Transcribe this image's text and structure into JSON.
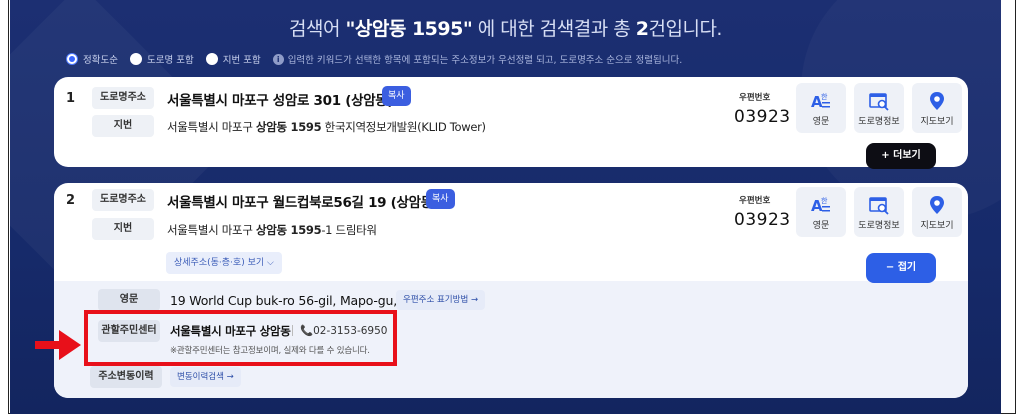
{
  "headline": {
    "prefix": "검색어 ",
    "keyword": "\"상암동 1595\"",
    "middle": " 에 대한 검색결과 총 ",
    "count": "2",
    "suffix": "건입니다."
  },
  "options": {
    "exact": "정확도순",
    "road": "도로명 포함",
    "jibun": "지번 포함",
    "info": "입력한 키워드가 선택한 항목에 포함되는 주소정보가 우선정렬 되고, 도로명주소 순으로 정렬됩니다."
  },
  "results": [
    {
      "num": "1",
      "road_tag": "도로명주소",
      "road_addr": "서울특별시 마포구 성암로 301 (상암동)",
      "copy": "복사",
      "jibun_tag": "지번",
      "jibun_pre": "서울특별시 마포구 ",
      "jibun_bold": "상암동 1595",
      "jibun_post": " 한국지역정보개발원(KLID Tower)",
      "zip_label": "우편번호",
      "zip": "03923",
      "btn_en": "영문",
      "btn_info": "도로명정보",
      "btn_map": "지도보기",
      "more": "+ 더보기"
    },
    {
      "num": "2",
      "road_tag": "도로명주소",
      "road_addr": "서울특별시 마포구 월드컵북로56길 19 (상암동)",
      "copy": "복사",
      "jibun_tag": "지번",
      "jibun_pre": "서울특별시 마포구 ",
      "jibun_bold": "상암동 1595",
      "jibun_post": "-1 드림타워",
      "zip_label": "우편번호",
      "zip": "03923",
      "btn_en": "영문",
      "btn_info": "도로명정보",
      "btn_map": "지도보기",
      "detail": "상세주소(동·층·호) 보기",
      "fold": "− 접기",
      "en_tag": "영문",
      "en_addr": "19 World Cup buk-ro 56-gil, Mapo-gu, Seoul",
      "en_btn": "우편주소 표기방법 →",
      "center_tag": "관할주민센터",
      "center_name": "서울특별시 마포구 상암동",
      "center_phone": "02-3153-6950",
      "center_note": "※관할주민센터는 참고정보이며, 실제와 다를 수 있습니다.",
      "history_tag": "주소변동이력",
      "history_btn": "변동이력검색 →"
    }
  ],
  "colors": {
    "highlight": "#e8101a",
    "primary": "#2d5fe6",
    "navy": "#1c2f72"
  }
}
